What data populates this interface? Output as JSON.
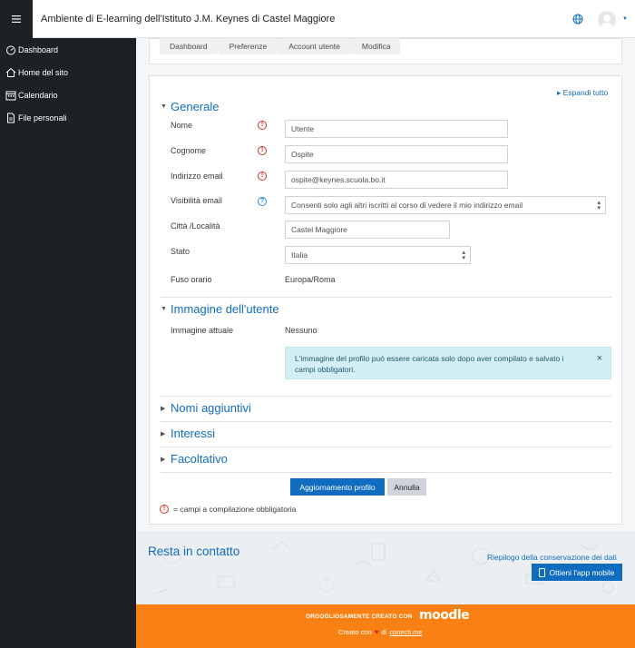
{
  "topbar": {
    "menu_icon": "hamburger-icon",
    "site_title": "Ambiente di E-learning dell'Istituto J.M. Keynes di Castel Maggiore",
    "language_icon": "globe-icon",
    "user_icon": "avatar-icon"
  },
  "sidebar": {
    "items": [
      {
        "label": "Dashboard",
        "icon": "dashboard-icon"
      },
      {
        "label": "Home del sito",
        "icon": "home-icon"
      },
      {
        "label": "Calendario",
        "icon": "calendar-icon"
      },
      {
        "label": "File personali",
        "icon": "file-icon"
      }
    ]
  },
  "breadcrumb": [
    "Dashboard",
    "Preferenze",
    "Account utente",
    "Modifica"
  ],
  "form": {
    "expand_all": "Espandi tutto",
    "sections": {
      "general": "Generale",
      "user_image": "Immagine dell'utente",
      "additional_names": "Nomi aggiuntivi",
      "interests": "Interessi",
      "optional": "Facoltativo"
    },
    "fields": {
      "first_name": {
        "label": "Nome",
        "value": "Utente"
      },
      "last_name": {
        "label": "Cognome",
        "value": "Ospite"
      },
      "email": {
        "label": "Indirizzo email",
        "value": "ospite@keynes.scuola.bo.it"
      },
      "email_visibility": {
        "label": "Visibilità email",
        "value": "Consenti solo agli altri iscritti al corso di vedere il mio indirizzo email"
      },
      "city": {
        "label": "Città /Località",
        "value": "Castel Maggiore"
      },
      "country": {
        "label": "Stato",
        "value": "Italia"
      },
      "timezone": {
        "label": "Fuso orario",
        "value": "Europa/Roma"
      },
      "current_image": {
        "label": "Immagine attuale",
        "value": "Nessuno"
      }
    },
    "image_alert": "L'immagine del profilo può essere caricata solo dopo aver compilato e salvato i campi obbligatori.",
    "submit_label": "Aggiornamento profilo",
    "cancel_label": "Annulla",
    "required_legend": "= campi a compilazione obbligatoria"
  },
  "footer": {
    "contact": "Resta in contatto",
    "data_retention": "Riepilogo della conservazione dei dati",
    "app_button": "Ottieni l'app mobile",
    "proudly": "ORGOGLIOSAMENTE CREATO CON",
    "logo": "moodle",
    "credit_prefix": "Creato con",
    "credit_mid": "di",
    "credit_link": "conecti.me"
  },
  "colors": {
    "brand": "#0f6cbf",
    "sidebar": "#1d2125",
    "required": "#ca3120",
    "footer": "#f98012"
  }
}
